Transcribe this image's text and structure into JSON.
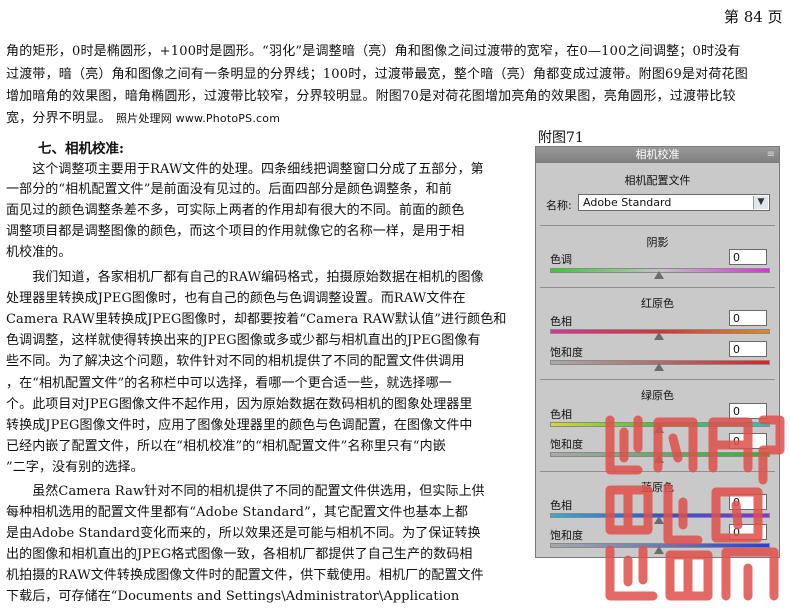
{
  "page_number": "第 84 页",
  "intro_lines": [
    "角的矩形，0时是椭圆形，+100时是圆形。“羽化”是调整暗（亮）角和图像之间过渡带的宽窄，在0—100之间调整；0时没有",
    "过渡带，暗（亮）角和图像之间有一条明显的分界线；100时，过渡带最宽，整个暗（亮）角都变成过渡带。附图69是对荷花图",
    "增加暗角的效果图，暗角椭圆形，过渡带比较窄，分界较明显。附图70是对荷花图增加亮角的效果图，亮角圆形，过渡带比较",
    "宽，分界不明显。"
  ],
  "credit": "照片处理网 www.PhotoPS.com",
  "section_heading": "七、相机校准:",
  "figure_label": "附图71",
  "body_lines": [
    "　　这个调整项主要用于RAW文件的处理。四条细线把调整窗口分成了五部分，第",
    "一部分的“相机配置文件”是前面没有见过的。后面四部分是颜色调整条，和前",
    "面见过的颜色调整条差不多，可实际上两者的作用却有很大的不同。前面的颜色",
    "调整项目都是调整图像的颜色，而这个项目的作用就像它的名称一样，是用于相",
    "机校准的。",
    "　　我们知道，各家相机厂都有自己的RAW编码格式，拍摄原始数据在相机的图像",
    "处理器里转换成JPEG图像时，也有自己的颜色与色调调整设置。而RAW文件在",
    "Camera RAW里转换成JPEG图像时，却都要按着“Camera RAW默认值”进行颜色和",
    "色调调整，这样就使得转换出来的JPEG图像或多或少都与相机直出的JPEG图像有",
    "些不同。为了解决这个问题，软件针对不同的相机提供了不同的配置文件供调用",
    "，在“相机配置文件”的名称栏中可以选择，看哪一个更合适一些，就选择哪一",
    "个。此项目对JPEG图像文件不起作用，因为原始数据在数码相机的图象处理器里",
    "转换成JPEG图像文件时，应用了图像处理器里的颜色与色调配置，在图像文件中",
    "已经内嵌了配置文件，所以在“相机校准”的“相机配置文件”名称里只有“内嵌",
    "”二字，没有别的选择。",
    "　　虽然Camera Raw针对不同的相机提供了不同的配置文件供选用，但实际上供",
    "每种相机选用的配置文件里都有“Adobe Standard”，其它配置文件也基本上都",
    "是由Adobe Standard变化而来的，所以效果还是可能与相机不同。为了保证转换",
    "出的图像和相机直出的JPEG格式图像一致，各相机厂都提供了自己生产的数码相",
    "机拍摄的RAW文件转换成图像文件时的配置文件，供下载使用。相机厂的配置文件",
    "下载后，可存储在“Documents and Settings\\Administrator\\Application"
  ],
  "panel": {
    "title": "相机校准",
    "menu_icon": "≡",
    "profile_heading": "相机配置文件",
    "name_label": "名称:",
    "profile_value": "Adobe Standard",
    "shadows": {
      "heading": "阴影",
      "tint_label": "色调",
      "tint_value": "0"
    },
    "red": {
      "heading": "红原色",
      "hue_label": "色相",
      "hue_value": "0",
      "sat_label": "饱和度",
      "sat_value": "0"
    },
    "green": {
      "heading": "绿原色",
      "hue_label": "色相",
      "hue_value": "0",
      "sat_label": "饱和度",
      "sat_value": "0"
    },
    "blue": {
      "heading": "蓝原色",
      "hue_label": "色相",
      "hue_value": "0",
      "sat_label": "饱和度",
      "sat_value": "0"
    }
  },
  "seal_color": "#e0504a"
}
